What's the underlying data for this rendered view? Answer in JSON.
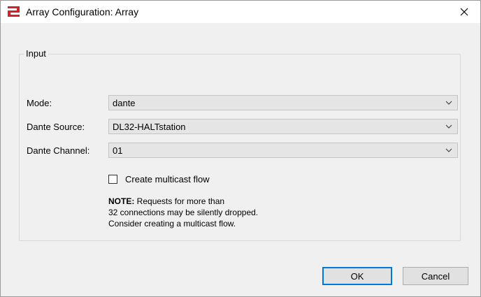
{
  "window": {
    "title": "Array Configuration: Array",
    "icon": "array-icon",
    "close_icon": "close-icon"
  },
  "group": {
    "title": "Input"
  },
  "fields": {
    "mode": {
      "label": "Mode:",
      "value": "dante"
    },
    "dante_source": {
      "label": "Dante Source:",
      "value": "DL32-HALTstation"
    },
    "dante_channel": {
      "label": "Dante Channel:",
      "value": "01"
    }
  },
  "multicast": {
    "label": "Create multicast flow",
    "checked": false
  },
  "note": {
    "bold": "NOTE:",
    "line1": " Requests for more than",
    "line2": "32 connections may be silently dropped.",
    "line3": "Consider creating a multicast flow."
  },
  "buttons": {
    "ok": "OK",
    "cancel": "Cancel"
  },
  "colors": {
    "accent": "#0078d7",
    "icon_red": "#d2232a"
  }
}
